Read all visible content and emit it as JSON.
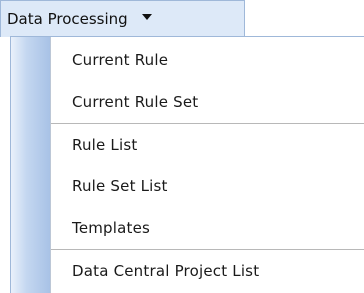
{
  "menu": {
    "title": "Data Processing",
    "caret_icon": "caret-down-icon",
    "items": [
      {
        "label": "Current Rule"
      },
      {
        "label": "Current Rule Set"
      },
      {
        "label": "Rule List"
      },
      {
        "label": "Rule Set List"
      },
      {
        "label": "Templates"
      },
      {
        "label": "Data Central Project List"
      }
    ]
  }
}
